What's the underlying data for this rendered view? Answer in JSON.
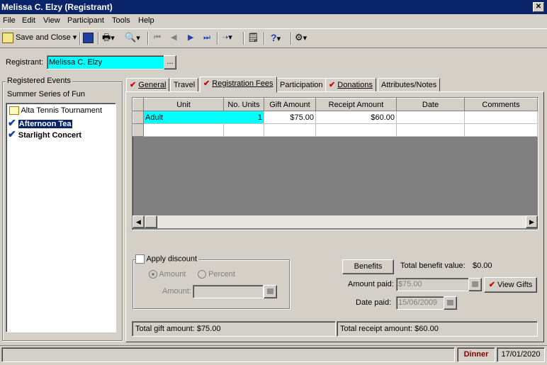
{
  "window": {
    "title": "Melissa C. Elzy (Registrant)",
    "close_glyph": "✕"
  },
  "menu": [
    "File",
    "Edit",
    "View",
    "Participant",
    "Tools",
    "Help"
  ],
  "toolbar": {
    "save_close_label": "Save and Close"
  },
  "registrant": {
    "label": "Registrant:",
    "value": "Melissa C. Elzy",
    "browse_label": "..."
  },
  "events": {
    "group_label": "Registered Events",
    "series": "Summer Series of Fun",
    "items": [
      {
        "label": "Alta Tennis Tournament",
        "checked": false
      },
      {
        "label": "Afternoon Tea",
        "checked": true
      },
      {
        "label": "Starlight Concert",
        "checked": true
      }
    ]
  },
  "tabs": [
    {
      "label": "General",
      "checked": true
    },
    {
      "label": "Travel",
      "checked": false
    },
    {
      "label": "Registration Fees",
      "checked": true,
      "active": true
    },
    {
      "label": "Participation",
      "checked": false
    },
    {
      "label": "Donations",
      "checked": true
    },
    {
      "label": "Attributes/Notes",
      "checked": false
    }
  ],
  "grid": {
    "columns": [
      "Unit",
      "No. Units",
      "Gift Amount",
      "Receipt Amount",
      "Date",
      "Comments"
    ],
    "rows": [
      {
        "unit": "Adult",
        "units": "1",
        "gift": "$75.00",
        "receipt": "$60.00",
        "date": "",
        "comments": ""
      }
    ]
  },
  "discount": {
    "apply_label": "Apply discount",
    "amount_radio": "Amount",
    "percent_radio": "Percent",
    "amount_label": "Amount:"
  },
  "benefits": {
    "button_label": "Benefits",
    "total_label": "Total benefit value:",
    "total_value": "$0.00",
    "amount_paid_label": "Amount paid:",
    "amount_paid_value": "$75.00",
    "view_gifts_label": "View Gifts",
    "date_paid_label": "Date paid:",
    "date_paid_value": "15/06/2009"
  },
  "totals": {
    "gift": "Total gift amount: $75.00",
    "receipt": "Total receipt amount: $60.00"
  },
  "status": {
    "database": "Dinner",
    "date": "17/01/2020"
  },
  "colors": {
    "titlebar": "#0a246a",
    "highlight": "#00ffff",
    "check": "#d00000",
    "status_text": "#8b0000"
  }
}
